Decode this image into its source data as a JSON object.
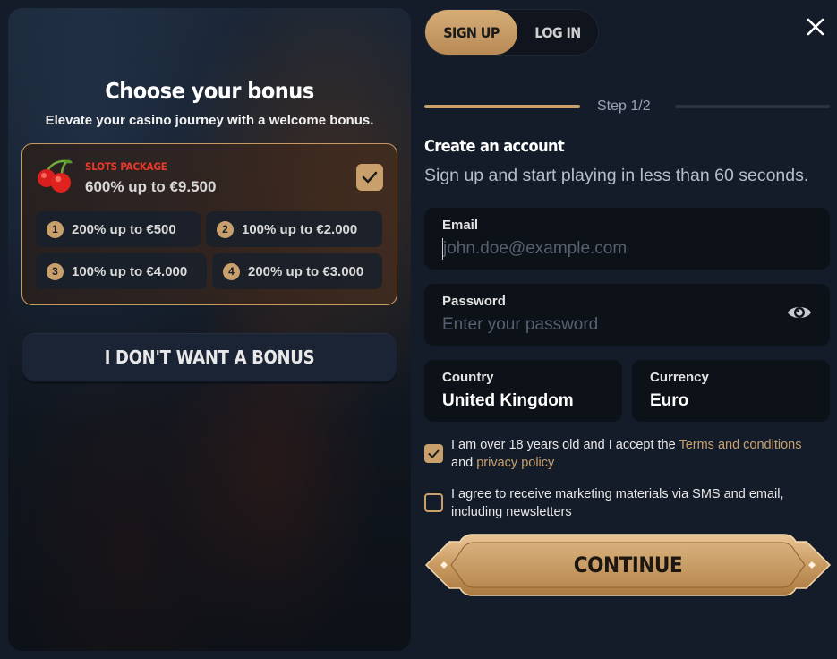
{
  "bonus": {
    "title": "Choose your bonus",
    "subtitle": "Elevate your casino journey with a welcome bonus.",
    "package": {
      "label": "SLOTS PACKAGE",
      "offer": "600% up to €9.500",
      "selected": true,
      "icon": "cherry-icon"
    },
    "deposits": [
      {
        "num": "1",
        "text": "200% up to €500"
      },
      {
        "num": "2",
        "text": "100% up to €2.000"
      },
      {
        "num": "3",
        "text": "100% up to €4.000"
      },
      {
        "num": "4",
        "text": "200% up to €3.000"
      }
    ],
    "no_bonus_label": "I DON'T WANT A BONUS"
  },
  "tabs": {
    "signup": "SIGN UP",
    "login": "LOG IN",
    "active": "signup"
  },
  "progress": {
    "step_text": "Step 1/2",
    "fraction": 0.5
  },
  "form": {
    "title": "Create an account",
    "subtitle": "Sign up and start playing in less than 60 seconds.",
    "email": {
      "label": "Email",
      "placeholder": "john.doe@example.com",
      "value": ""
    },
    "password": {
      "label": "Password",
      "placeholder": "Enter your password",
      "value": ""
    },
    "country": {
      "label": "Country",
      "value": "United Kingdom"
    },
    "currency": {
      "label": "Currency",
      "value": "Euro"
    }
  },
  "consents": {
    "age": {
      "checked": true,
      "text_before": "I am over 18 years old and I accept the ",
      "terms_link": "Terms and conditions",
      "text_and": " and ",
      "privacy_link": "privacy policy"
    },
    "marketing": {
      "checked": false,
      "text": "I agree to receive marketing materials via SMS and email, including newsletters"
    }
  },
  "continue_label": "CONTINUE",
  "colors": {
    "accent": "#c9a06c",
    "background": "#141c2a",
    "field_bg": "#0d1219",
    "package_label": "#e83b2e"
  }
}
